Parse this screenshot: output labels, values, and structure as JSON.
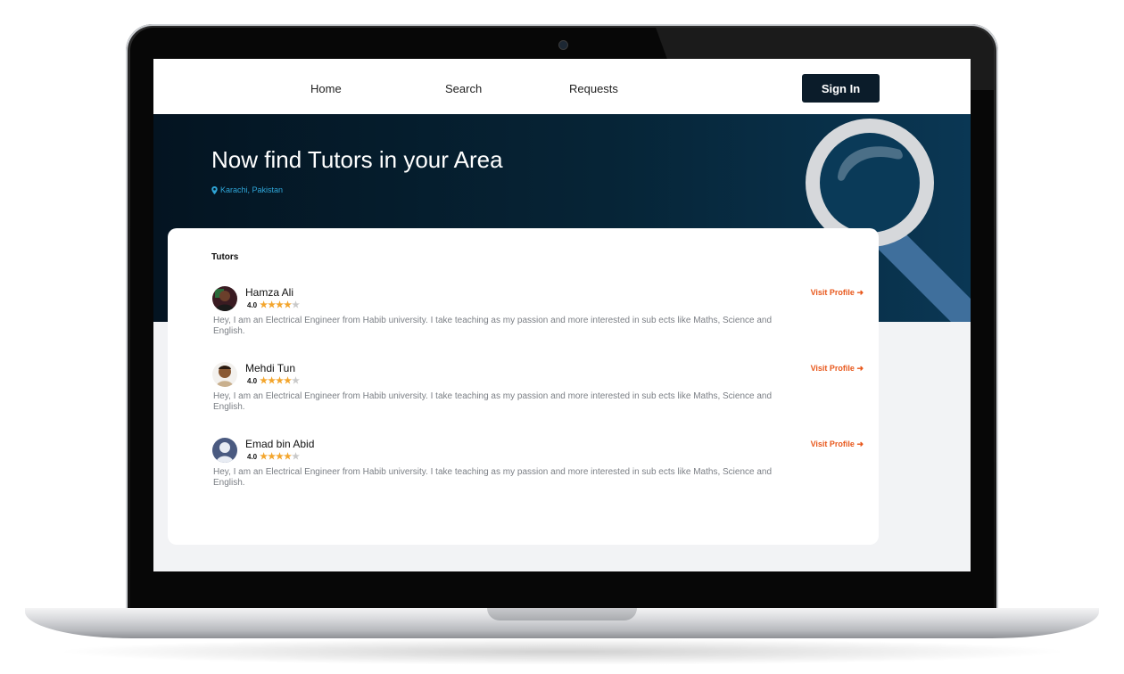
{
  "nav": {
    "home": "Home",
    "search": "Search",
    "requests": "Requests",
    "signin": "Sign In"
  },
  "hero": {
    "title": "Now find Tutors in your Area",
    "location": "Karachi, Pakistan",
    "location_icon": "map-pin-icon"
  },
  "tutors_section": {
    "title": "Tutors",
    "items": [
      {
        "name": "Hamza Ali",
        "rating": "4.0",
        "stars": 4,
        "bio": "Hey, I am an Electrical Engineer from Habib university. I take teaching as my passion and more interested in sub ects like Maths, Science and English.",
        "link": "Visit Profile",
        "avatar": "photo"
      },
      {
        "name": "Mehdi Tun",
        "rating": "4.0",
        "stars": 4,
        "bio": "Hey, I am an Electrical Engineer from Habib university. I take teaching as my passion and more interested in sub ects like Maths, Science and English.",
        "link": "Visit Profile",
        "avatar": "photo"
      },
      {
        "name": "Emad bin Abid",
        "rating": "4.0",
        "stars": 4,
        "bio": "Hey, I am an Electrical Engineer from Habib university. I take teaching as my passion and more interested in sub ects like Maths, Science and English.",
        "link": "Visit Profile",
        "avatar": "default-user"
      }
    ]
  },
  "colors": {
    "accent": "#e8581c",
    "hero_dark": "#041421",
    "signin_bg": "#0b1c2a",
    "star": "#f3a52c"
  }
}
